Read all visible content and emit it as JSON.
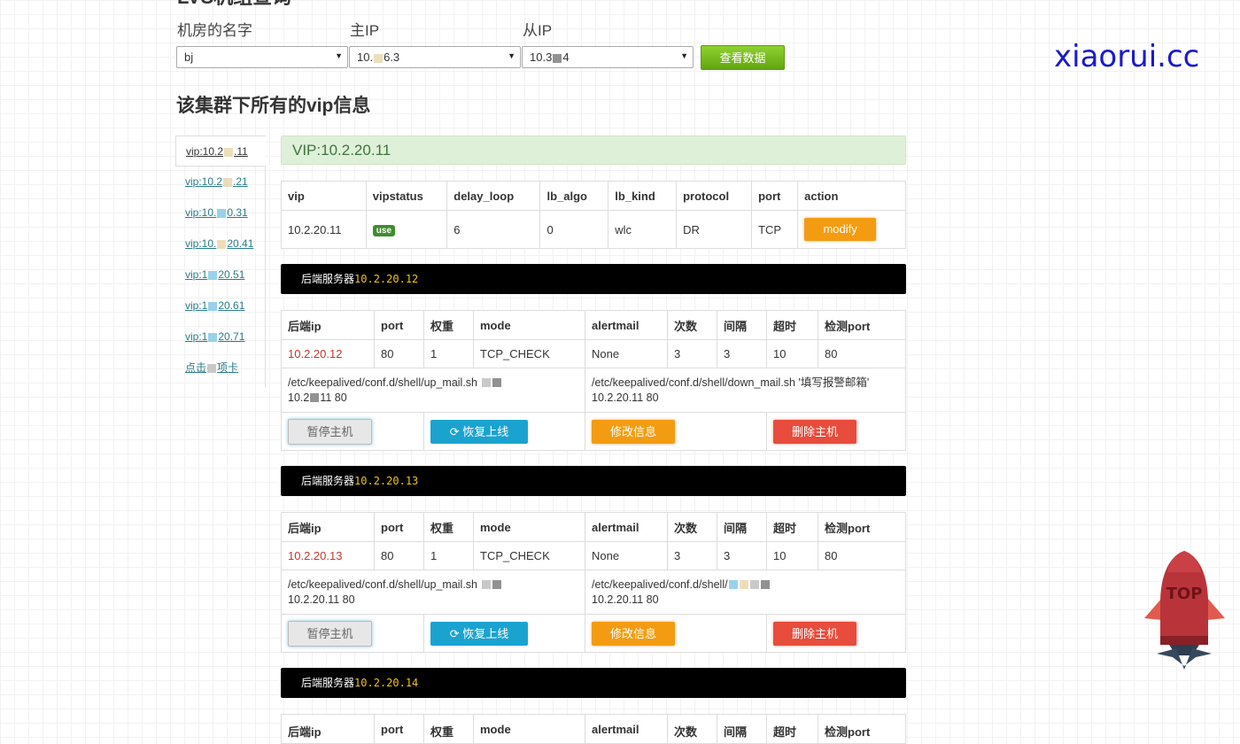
{
  "page": {
    "title": "LVS机组查询",
    "brand": "xiaorui.cc"
  },
  "filters": {
    "room_label": "机房的名字",
    "master_label": "主IP",
    "slave_label": "从IP",
    "room_value": "bj",
    "master_value_start": "10.",
    "master_value_end": "6.3",
    "slave_value_start": "10.3",
    "slave_value_end": "4",
    "query_button": "查看数据"
  },
  "section_title": "该集群下所有的vip信息",
  "sidebar": {
    "items": [
      {
        "start": "vip:10.2",
        "end": ".11"
      },
      {
        "start": "vip:10.2",
        "end": ".21"
      },
      {
        "start": "vip:10.",
        "end": "0.31"
      },
      {
        "start": "vip:10.",
        "end": "20.41"
      },
      {
        "start": "vip:1",
        "end": "20.51"
      },
      {
        "start": "vip:1",
        "end": "20.61"
      },
      {
        "start": "vip:1",
        "end": "20.71"
      },
      {
        "start": "点击",
        "end": "项卡"
      }
    ]
  },
  "vip_header": "VIP:10.2.20.11",
  "vip_table": {
    "headers": [
      "vip",
      "vipstatus",
      "delay_loop",
      "lb_algo",
      "lb_kind",
      "protocol",
      "port",
      "action"
    ],
    "row": {
      "vip": "10.2.20.11",
      "vipstatus": "use",
      "delay_loop": "6",
      "lb_algo": "0",
      "lb_kind": "wlc",
      "protocol": "DR",
      "port": "TCP",
      "action": "modify"
    }
  },
  "server_prefix": "后端服务器",
  "server_headers": [
    "后端ip",
    "port",
    "权重",
    "mode",
    "alertmail",
    "次数",
    "间隔",
    "超时",
    "检测port"
  ],
  "buttons": {
    "pause": "暂停主机",
    "restore": "恢复上线",
    "edit": "修改信息",
    "delete": "删除主机"
  },
  "servers": [
    {
      "ip": "10.2.20.12",
      "port": "80",
      "weight": "1",
      "mode": "TCP_CHECK",
      "alertmail": "None",
      "times": "3",
      "interval": "3",
      "timeout": "10",
      "check_port": "80",
      "up_cmd": "/etc/keepalived/conf.d/shell/up_mail.sh",
      "up_cmd_tail": "10.2",
      "up_cmd_tail_end": "11 80",
      "down_cmd": "/etc/keepalived/conf.d/shell/down_mail.sh '填写报警邮箱'",
      "down_cmd_tail": "10.2.20.11 80"
    },
    {
      "ip": "10.2.20.13",
      "port": "80",
      "weight": "1",
      "mode": "TCP_CHECK",
      "alertmail": "None",
      "times": "3",
      "interval": "3",
      "timeout": "10",
      "check_port": "80",
      "up_cmd": "/etc/keepalived/conf.d/shell/up_mail.sh",
      "up_cmd_tail": "10.2.20.11 80",
      "down_cmd": "/etc/keepalived/conf.d/shell/",
      "down_cmd_tail": "10.2.20.11 80"
    },
    {
      "ip": "10.2.20.14"
    }
  ],
  "top_button": "TOP"
}
